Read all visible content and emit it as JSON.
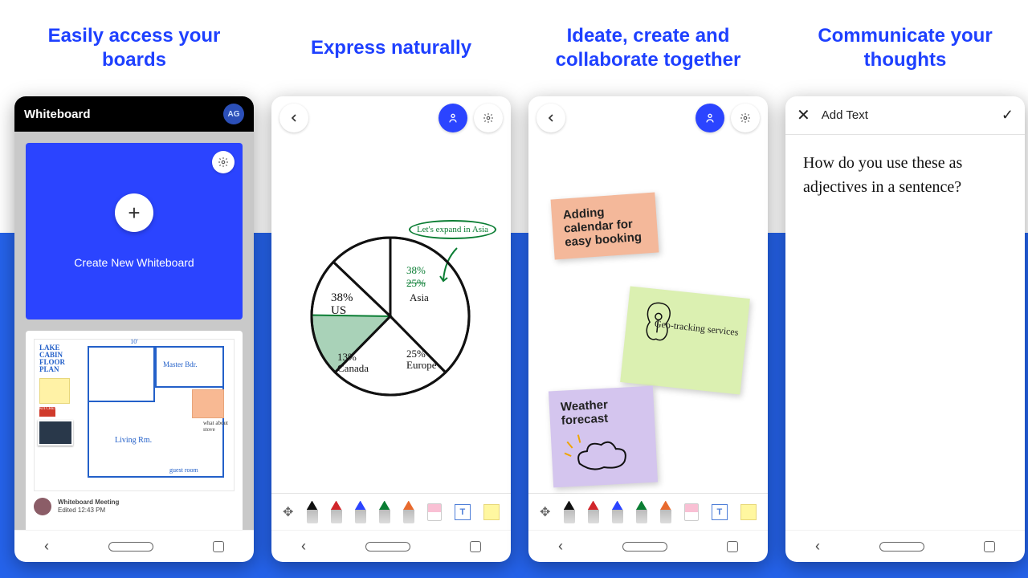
{
  "captions": {
    "c1": "Easily access your boards",
    "c2": "Express naturally",
    "c3": "Ideate, create and collaborate together",
    "c4": "Communicate your thoughts"
  },
  "phone1": {
    "app_title": "Whiteboard",
    "avatar_initials": "AG",
    "create_label": "Create New Whiteboard",
    "floorplan_title": "LAKE CABIN FLOOR PLAN",
    "rooms": {
      "master": "Master Bdr.",
      "living": "Living Rm.",
      "guest": "guest room"
    },
    "dims": "10'",
    "side_note": "what about stove",
    "red_tag": "KITCHEN",
    "board_title": "Whiteboard Meeting",
    "board_subtitle": "Edited 12:43 PM"
  },
  "phone2": {
    "callout": "Let's expand in Asia",
    "asia_pct": "38%",
    "asia_old": "25%",
    "asia_name": "Asia"
  },
  "phone3": {
    "note1": "Adding calendar for easy booking",
    "note2": "Geo-tracking services",
    "note3": "Weather forecast"
  },
  "phone4": {
    "title": "Add Text",
    "body": "How do you use these as adjectives in a sentence?"
  },
  "chart_data": {
    "type": "pie",
    "title": "",
    "slices": [
      {
        "label": "US",
        "value": 38
      },
      {
        "label": "Asia",
        "value": 25,
        "proposed": 38
      },
      {
        "label": "Europe",
        "value": 25
      },
      {
        "label": "Canada",
        "value": 13
      }
    ],
    "annotation": "Let's expand in Asia",
    "colors": {
      "stroke": "#111111",
      "highlight": "#0a7d33"
    }
  },
  "pen_colors": [
    "#111111",
    "#d1262b",
    "#2b44ff",
    "#0a7d33",
    "#e86a2e"
  ]
}
